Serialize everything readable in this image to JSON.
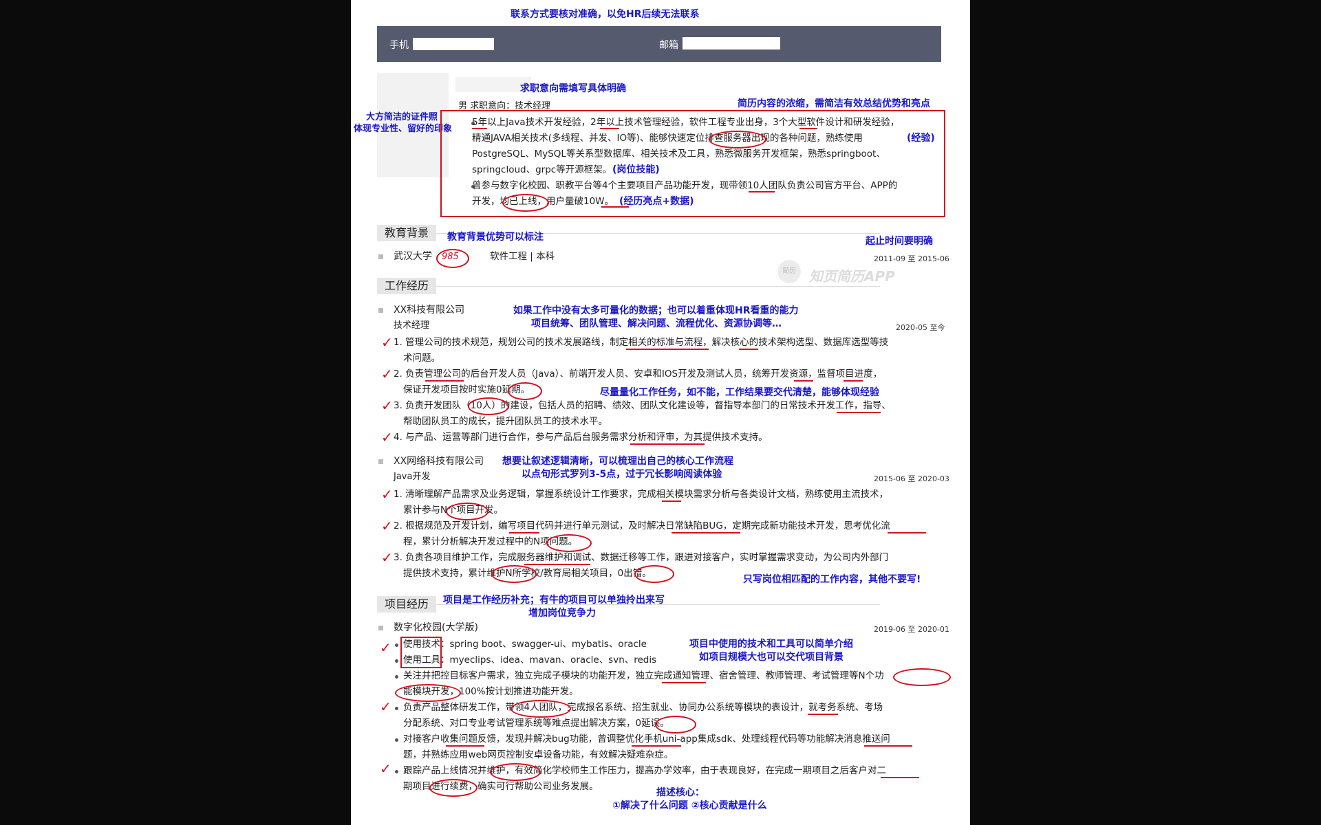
{
  "notes": {
    "contact": "联系方式要核对准确，以免HR后续无法联系",
    "intent": "求职意向需填写具体明确",
    "concise": "简历内容的浓缩，需简洁有效总结优势和亮点",
    "photo_line1": "大方简洁的证件照",
    "photo_line2": "体现专业性、留好的印象",
    "edu": "教育背景优势可以标注",
    "time": "起止时间要明确",
    "work1_line1": "如果工作中没有太多可量化的数据；也可以着重体现HR看重的能力",
    "work1_line2": "项目统筹、团队管理、解决问题、流程优化、资源协调等…",
    "quantify": "尽量量化工作任务，如不能，工作结果要交代清楚，能够体现经验",
    "logic_line1": "想要让叙述逻辑清晰，可以梳理出自己的核心工作流程",
    "logic_line2": "以点句形式罗列3-5点，过于冗长影响阅读体验",
    "match": "只写岗位相匹配的工作内容，其他不要写!",
    "project_line1": "项目是工作经历补充；有牛的项目可以单独拎出来写",
    "project_line2": "增加岗位竞争力",
    "tech_line1": "项目中使用的技术和工具可以简单介绍",
    "tech_line2": "如项目规模大也可以交代项目背景",
    "core_line1": "描述核心：",
    "core_line2": "①解决了什么问题  ②核心贡献是什么"
  },
  "contact": {
    "phone_label": "手机",
    "email_label": "邮箱"
  },
  "profile": {
    "gender_intent": "男   求职意向：技术经理"
  },
  "summary": {
    "b1_l1": "5年以上Java技术开发经验，2年以上技术管理经验，软件工程专业出身，3个大型软件设计和研发经验，",
    "b1_l2": "精通JAVA相关技术(多线程、并发、IO等)、能够快速定位排查服务器出现的各种问题，熟练使用",
    "b1_l2_tag": "(经验)",
    "b1_l3": "PostgreSQL、MySQL等关系型数据库、相关技术及工具，熟悉微服务开发框架，熟悉springboot、",
    "b1_l4": "springcloud、grpc等开源框架。",
    "b1_l4_tag": "(岗位技能)",
    "b2_l1": "曾参与数字化校园、职教平台等4个主要项目产品功能开发，现带领10人团队负责公司官方平台、APP的",
    "b2_l2": "开发，均已上线，用户量破10W。",
    "b2_l2_tag": "(经历亮点+数据)"
  },
  "education": {
    "title": "教育背景",
    "school": "武汉大学",
    "tag": "985",
    "major": "软件工程 | 本科",
    "dates": "2011-09 至 2015-06"
  },
  "watermark": {
    "text": "知页简历APP",
    "badge": "简历"
  },
  "work": {
    "title": "工作经历",
    "job1": {
      "company": "XX科技有限公司",
      "role": "技术经理",
      "dates": "2020-05 至今",
      "i1_l1": "1. 管理公司的技术规范，规划公司的技术发展路线，制定相关的标准与流程，解决核心的技术架构选型、数据库选型等技",
      "i1_l2": "术问题。",
      "i2_l1": "2. 负责管理公司的后台开发人员（Java）、前端开发人员、安卓和IOS开发及测试人员，统筹开发资源，监督项目进度，",
      "i2_l2": "保证开发项目按时实施0延期。",
      "i3_l1": "3. 负责开发团队（10人）的建设，包括人员的招聘、绩效、团队文化建设等，督指导本部门的日常技术开发工作，指导、",
      "i3_l2": "帮助团队员工的成长，提升团队员工的技术水平。",
      "i4_l1": "4. 与产品、运营等部门进行合作，参与产品后台服务需求分析和评审，为其提供技术支持。"
    },
    "job2": {
      "company": "XX网络科技有限公司",
      "role": "Java开发",
      "dates": "2015-06 至 2020-03",
      "i1_l1": "1. 清晰理解产品需求及业务逻辑，掌握系统设计工作要求，完成相关模块需求分析与各类设计文档，熟练使用主流技术，",
      "i1_l2": "累计参与N个项目开发。",
      "i2_l1": "2. 根据规范及开发计划，编写项目代码并进行单元测试，及时解决日常缺陷BUG，定期完成新功能技术开发，思考优化流",
      "i2_l2": "程，累计分析解决开发过程中的N项问题。",
      "i3_l1": "3. 负责各项目维护工作，完成服务器维护和调试、数据迁移等工作，跟进对接客户，实时掌握需求变动，为公司内外部门",
      "i3_l2": "提供技术支持，累计维护N所学校/教育局相关项目，0出错。"
    }
  },
  "project": {
    "title": "项目经历",
    "name": "数字化校园(大学版)",
    "dates": "2019-06 至 2020-01",
    "b1": "使用技术：spring boot、swagger-ui、mybatis、oracle",
    "b2": "使用工具：myeclips、idea、mavan、oracle、svn、redis",
    "b3_l1": "关注并把控目标客户需求，独立完成子模块的功能开发，独立完成通知管理、宿舍管理、教师管理、考试管理等N个功",
    "b3_l2": "能模块开发，100%按计划推进功能开发。",
    "b4_l1": "负责产品整体研发工作，带领4人团队，完成报名系统、招生就业、协同办公系统等模块的表设计，就考务系统、考场",
    "b4_l2": "分配系统、对口专业考试管理系统等难点提出解决方案，0延误。",
    "b5_l1": "对接客户收集问题反馈，发现并解决bug功能，曾调整优化手机uni-app集成sdk、处理线程代码等功能解决消息推送问",
    "b5_l2": "题，并熟练应用web网页控制安卓设备功能，有效解决疑难杂症。",
    "b6_l1": "跟踪产品上线情况并维护，有效简化学校师生工作压力，提高办学效率，由于表现良好，在完成一期项目之后客户对二",
    "b6_l2": "期项目进行续费，确实可行帮助公司业务发展。"
  }
}
